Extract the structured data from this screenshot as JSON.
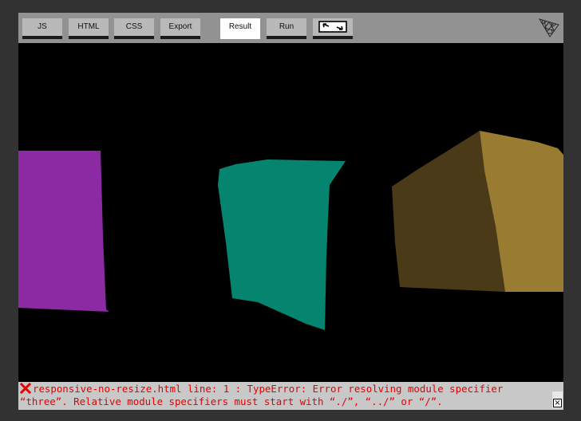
{
  "toolbar": {
    "buttons": {
      "js": "JS",
      "html": "HTML",
      "css": "CSS",
      "export": "Export",
      "result": "Result",
      "run": "Run"
    },
    "active": "Result",
    "fullscreen_icon": "fullscreen-toggle-icon",
    "logo_icon": "threejs-logo-icon"
  },
  "scene": {
    "cube_colors": {
      "left": "#8b2aa3",
      "middle": "#05846f",
      "right_dark": "#4b3a18",
      "right_light": "#9a7b32"
    }
  },
  "error": {
    "icon": "error-x-icon",
    "line1": "responsive-no-resize.html line: 1 : TypeError: Error resolving module specifier",
    "line2": "“three”. Relative module specifiers must start with “./”, “../” or “/”.",
    "close_symbol": "×"
  }
}
